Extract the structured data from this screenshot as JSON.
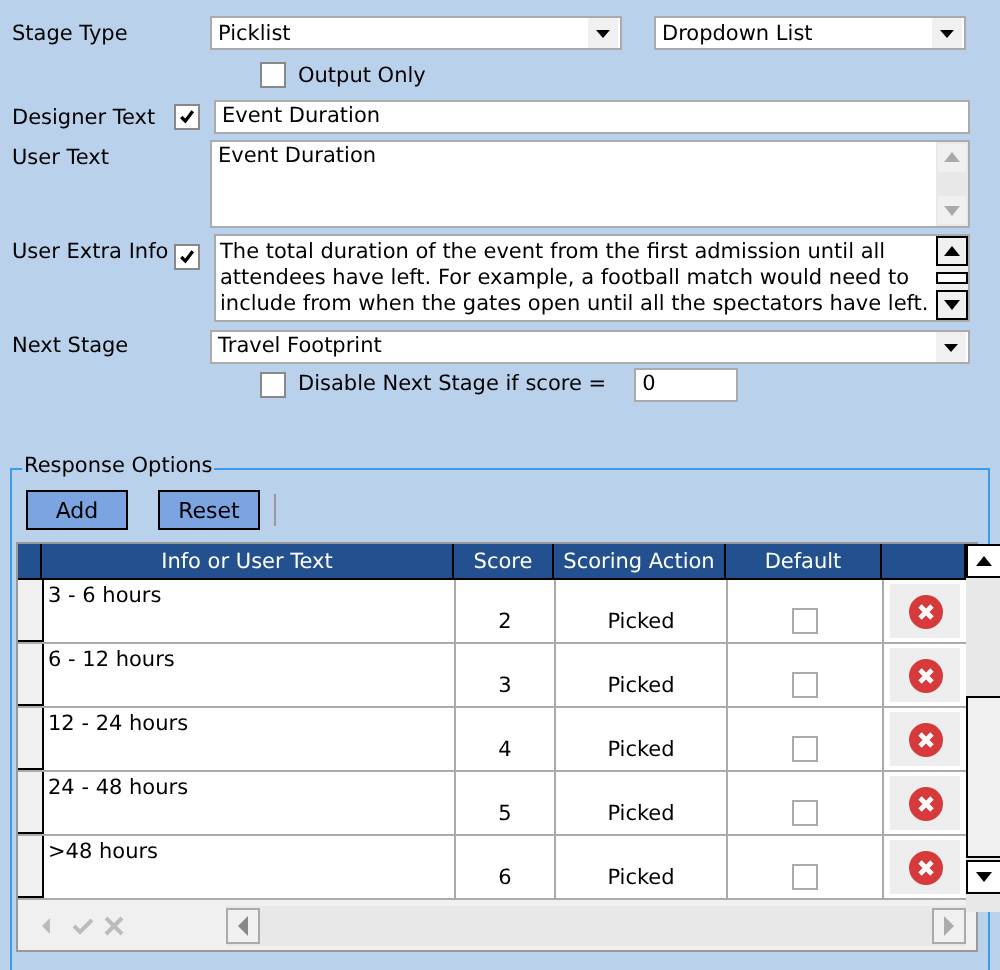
{
  "stage_type": {
    "label": "Stage Type",
    "value": "Picklist",
    "display": "Dropdown List"
  },
  "output_only": {
    "label": "Output Only",
    "checked": false
  },
  "designer_text": {
    "label": "Designer Text",
    "checked": true,
    "value": "Event Duration"
  },
  "user_text": {
    "label": "User Text",
    "value": "Event Duration"
  },
  "user_extra_info": {
    "label": "User Extra Info",
    "checked": true,
    "value": "The total duration of the event from the first admission until all attendees have left. For example, a football match would need to include from when the gates open until all the spectators have left."
  },
  "next_stage": {
    "label": "Next Stage",
    "value": "Travel Footprint"
  },
  "disable_next": {
    "label": "Disable Next Stage if score =",
    "checked": false,
    "value": "0"
  },
  "response_options": {
    "title": "Response Options",
    "buttons": [
      "Add",
      "Reset"
    ],
    "columns": [
      "Info or User Text",
      "Score",
      "Scoring Action",
      "Default"
    ],
    "rows": [
      {
        "text": "3 - 6 hours",
        "score": "2",
        "action": "Picked",
        "default": false
      },
      {
        "text": "6 - 12 hours",
        "score": "3",
        "action": "Picked",
        "default": false
      },
      {
        "text": "12 - 24 hours",
        "score": "4",
        "action": "Picked",
        "default": false
      },
      {
        "text": "24 - 48 hours",
        "score": "5",
        "action": "Picked",
        "default": false
      },
      {
        "text": ">48 hours",
        "score": "6",
        "action": "Picked",
        "default": false
      }
    ]
  }
}
